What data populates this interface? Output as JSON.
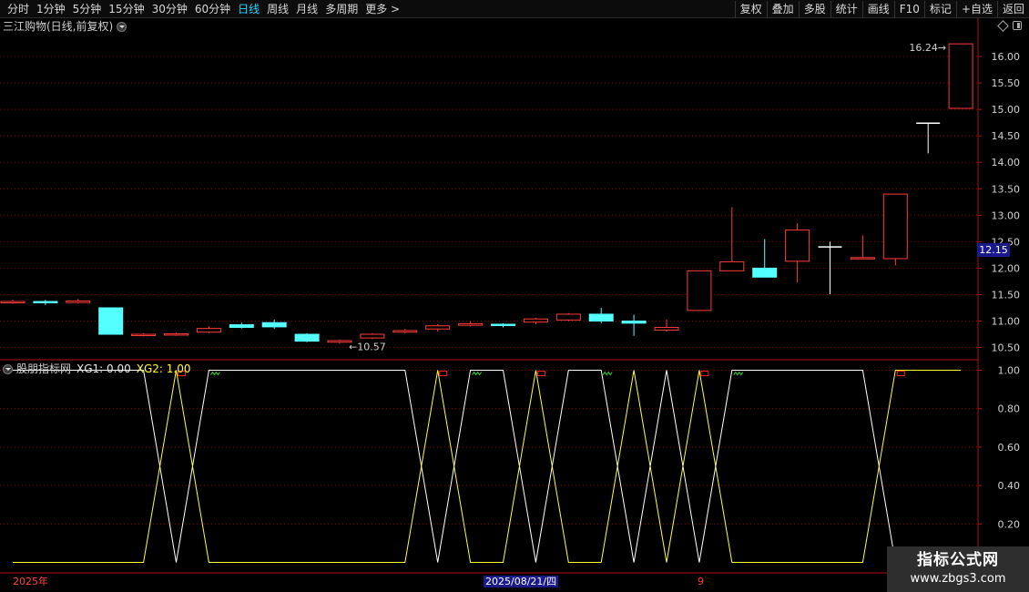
{
  "toolbar": {
    "periods": [
      "分时",
      "1分钟",
      "5分钟",
      "15分钟",
      "30分钟",
      "60分钟",
      "日线",
      "周线",
      "月线",
      "多周期",
      "更多 >"
    ],
    "active_period": "日线",
    "right_buttons": [
      "复权",
      "叠加",
      "多股",
      "统计",
      "画线",
      "F10",
      "标记",
      "+自选",
      "返回"
    ]
  },
  "main": {
    "title": "三江购物(日线,前复权)",
    "current_price_label": "12.15"
  },
  "indicator": {
    "name": "股朋指标网",
    "xg1_text": "XG1: 0.00",
    "xg2_text": "XG2: 1.00"
  },
  "bottom_axis": {
    "year_label": "2025年",
    "cursor_date": "2025/08/21/四",
    "month_label": "9"
  },
  "watermark": {
    "title": "指标公式网",
    "url": "www.zbgs3.com"
  },
  "colors": {
    "up": "#ff3b3b",
    "down": "#54ffff",
    "grid": "#8a0000",
    "xg1_line": "#ffffff",
    "xg2_line": "#ffff33",
    "axis_label": "#d0d0d0",
    "signal_buy": "#ff2020",
    "signal_sell": "#33cc33"
  },
  "chart_data": [
    {
      "type": "candlestick",
      "title": "三江购物(日线,前复权)",
      "y_ticks": [
        10.5,
        11.0,
        11.5,
        12.0,
        12.5,
        13.0,
        13.5,
        14.0,
        14.5,
        15.0,
        15.5,
        16.0
      ],
      "ylim": [
        10.32,
        16.38
      ],
      "annotations": [
        {
          "text": "10.57",
          "price": 10.57,
          "kind": "low"
        },
        {
          "text": "16.24",
          "price": 16.24,
          "kind": "high"
        }
      ],
      "candles": [
        {
          "o": 11.35,
          "c": 11.37,
          "h": 11.4,
          "l": 11.32
        },
        {
          "o": 11.37,
          "c": 11.35,
          "h": 11.4,
          "l": 11.3
        },
        {
          "o": 11.35,
          "c": 11.38,
          "h": 11.42,
          "l": 11.33
        },
        {
          "o": 11.25,
          "c": 10.75,
          "h": 11.25,
          "l": 10.75
        },
        {
          "o": 10.73,
          "c": 10.75,
          "h": 10.77,
          "l": 10.71
        },
        {
          "o": 10.74,
          "c": 10.76,
          "h": 10.78,
          "l": 10.72
        },
        {
          "o": 10.79,
          "c": 10.86,
          "h": 10.9,
          "l": 10.77
        },
        {
          "o": 10.93,
          "c": 10.88,
          "h": 10.97,
          "l": 10.86
        },
        {
          "o": 10.97,
          "c": 10.89,
          "h": 11.03,
          "l": 10.85
        },
        {
          "o": 10.75,
          "c": 10.62,
          "h": 10.77,
          "l": 10.6
        },
        {
          "o": 10.6,
          "c": 10.63,
          "h": 10.65,
          "l": 10.57
        },
        {
          "o": 10.68,
          "c": 10.75,
          "h": 10.77,
          "l": 10.66
        },
        {
          "o": 10.79,
          "c": 10.82,
          "h": 10.85,
          "l": 10.77
        },
        {
          "o": 10.85,
          "c": 10.91,
          "h": 10.94,
          "l": 10.8
        },
        {
          "o": 10.92,
          "c": 10.95,
          "h": 11.0,
          "l": 10.9
        },
        {
          "o": 10.94,
          "c": 10.92,
          "h": 10.96,
          "l": 10.88
        },
        {
          "o": 10.98,
          "c": 11.04,
          "h": 11.06,
          "l": 10.94
        },
        {
          "o": 11.02,
          "c": 11.13,
          "h": 11.15,
          "l": 11.0
        },
        {
          "o": 11.13,
          "c": 11.0,
          "h": 11.25,
          "l": 10.96
        },
        {
          "o": 11.0,
          "c": 10.96,
          "h": 11.12,
          "l": 10.72
        },
        {
          "o": 10.83,
          "c": 10.88,
          "h": 11.03,
          "l": 10.8
        },
        {
          "o": 11.2,
          "c": 11.95,
          "h": 11.95,
          "l": 11.2
        },
        {
          "o": 11.95,
          "c": 12.12,
          "h": 13.15,
          "l": 11.95
        },
        {
          "o": 12.0,
          "c": 11.83,
          "h": 12.55,
          "l": 11.83
        },
        {
          "o": 12.13,
          "c": 12.72,
          "h": 12.85,
          "l": 11.73
        },
        {
          "o": 12.4,
          "c": 12.4,
          "h": 12.5,
          "l": 11.51
        },
        {
          "o": 12.18,
          "c": 12.2,
          "h": 12.62,
          "l": 12.18
        },
        {
          "o": 12.18,
          "c": 13.4,
          "h": 13.4,
          "l": 12.05
        },
        {
          "o": 14.74,
          "c": 14.74,
          "h": 14.74,
          "l": 14.17
        },
        {
          "o": 15.02,
          "c": 16.24,
          "h": 16.24,
          "l": 15.02
        }
      ]
    },
    {
      "type": "line",
      "title": "股朋指标网",
      "y_ticks": [
        0.2,
        0.4,
        0.6,
        0.8,
        1.0
      ],
      "ylim": [
        -0.05,
        1.05
      ],
      "series": [
        {
          "name": "XG1",
          "values": [
            1,
            1,
            1,
            1,
            1,
            0,
            1,
            1,
            1,
            1,
            1,
            1,
            1,
            0,
            1,
            1,
            0,
            1,
            1,
            0,
            1,
            0,
            1,
            1,
            1,
            1,
            1,
            0,
            0,
            0
          ]
        },
        {
          "name": "XG2",
          "values": [
            0,
            0,
            0,
            0,
            0,
            1,
            0,
            0,
            0,
            0,
            0,
            0,
            0,
            1,
            0,
            0,
            1,
            0,
            0,
            1,
            0,
            1,
            0,
            0,
            0,
            0,
            0,
            1,
            1,
            1
          ]
        }
      ],
      "signals": [
        {
          "bar": 5,
          "kind": "buy"
        },
        {
          "bar": 6,
          "kind": "sell"
        },
        {
          "bar": 13,
          "kind": "buy"
        },
        {
          "bar": 14,
          "kind": "sell"
        },
        {
          "bar": 16,
          "kind": "buy"
        },
        {
          "bar": 18,
          "kind": "sell"
        },
        {
          "bar": 21,
          "kind": "buy"
        },
        {
          "bar": 22,
          "kind": "sell"
        },
        {
          "bar": 27,
          "kind": "buy"
        }
      ]
    }
  ]
}
